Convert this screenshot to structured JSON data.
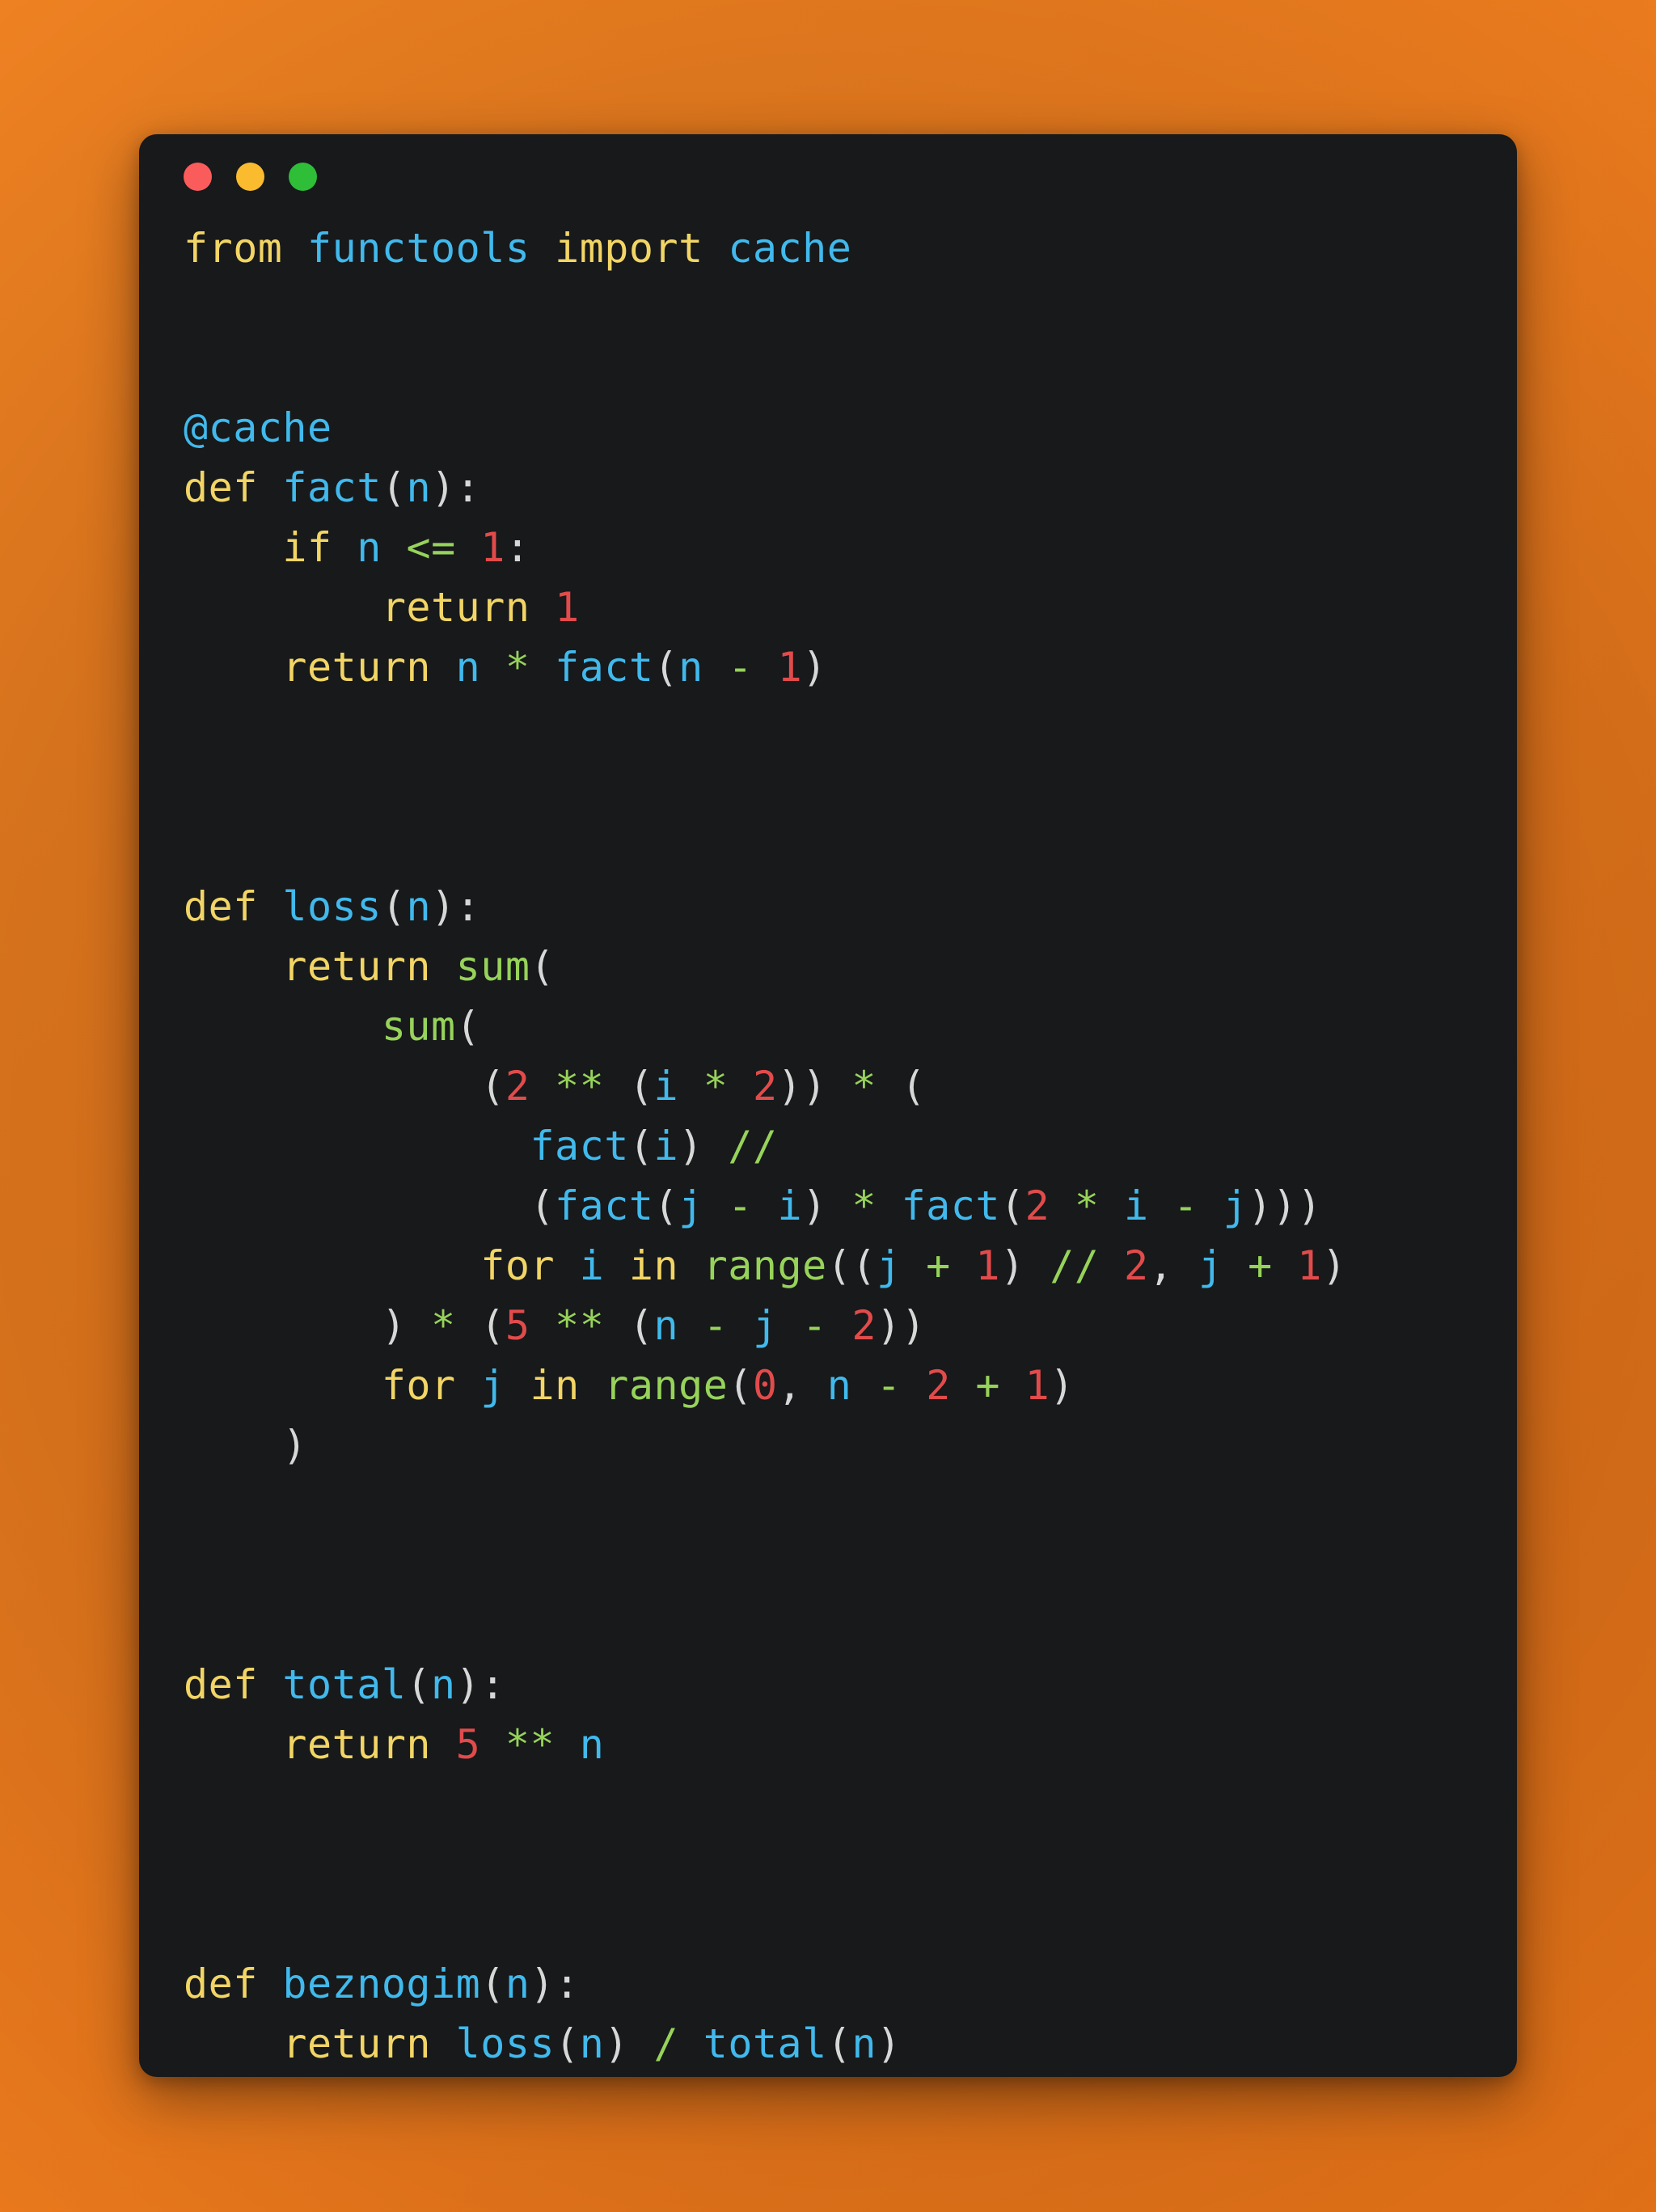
{
  "window": {
    "background_color": "#17191B",
    "page_background_color": "#EC7C1E",
    "traffic_lights": [
      {
        "name": "close",
        "color": "#FA5C5C"
      },
      {
        "name": "minimize",
        "color": "#FBBB2E"
      },
      {
        "name": "maximize",
        "color": "#2EBE37"
      }
    ]
  },
  "syntax_colors": {
    "keyword": "#F2D565",
    "identifier": "#41B9EC",
    "builtin": "#97D35A",
    "operator": "#97D35A",
    "number": "#E24B4B",
    "punctuation": "#D6D8D8"
  },
  "code": {
    "language": "python",
    "lines": [
      [
        {
          "t": "from",
          "c": "kw"
        },
        {
          "t": " ",
          "c": "pn"
        },
        {
          "t": "functools",
          "c": "id"
        },
        {
          "t": " ",
          "c": "pn"
        },
        {
          "t": "import",
          "c": "kw"
        },
        {
          "t": " ",
          "c": "pn"
        },
        {
          "t": "cache",
          "c": "id"
        }
      ],
      [],
      [],
      [
        {
          "t": "@cache",
          "c": "id"
        }
      ],
      [
        {
          "t": "def",
          "c": "kw"
        },
        {
          "t": " ",
          "c": "pn"
        },
        {
          "t": "fact",
          "c": "id"
        },
        {
          "t": "(",
          "c": "pn"
        },
        {
          "t": "n",
          "c": "id"
        },
        {
          "t": "):",
          "c": "pn"
        }
      ],
      [
        {
          "t": "    ",
          "c": "pn"
        },
        {
          "t": "if",
          "c": "kw"
        },
        {
          "t": " ",
          "c": "pn"
        },
        {
          "t": "n",
          "c": "id"
        },
        {
          "t": " ",
          "c": "pn"
        },
        {
          "t": "<=",
          "c": "op"
        },
        {
          "t": " ",
          "c": "pn"
        },
        {
          "t": "1",
          "c": "num"
        },
        {
          "t": ":",
          "c": "pn"
        }
      ],
      [
        {
          "t": "        ",
          "c": "pn"
        },
        {
          "t": "return",
          "c": "kw"
        },
        {
          "t": " ",
          "c": "pn"
        },
        {
          "t": "1",
          "c": "num"
        }
      ],
      [
        {
          "t": "    ",
          "c": "pn"
        },
        {
          "t": "return",
          "c": "kw"
        },
        {
          "t": " ",
          "c": "pn"
        },
        {
          "t": "n",
          "c": "id"
        },
        {
          "t": " ",
          "c": "pn"
        },
        {
          "t": "*",
          "c": "op"
        },
        {
          "t": " ",
          "c": "pn"
        },
        {
          "t": "fact",
          "c": "id"
        },
        {
          "t": "(",
          "c": "pn"
        },
        {
          "t": "n",
          "c": "id"
        },
        {
          "t": " ",
          "c": "pn"
        },
        {
          "t": "-",
          "c": "op"
        },
        {
          "t": " ",
          "c": "pn"
        },
        {
          "t": "1",
          "c": "num"
        },
        {
          "t": ")",
          "c": "pn"
        }
      ],
      [],
      [],
      [],
      [
        {
          "t": "def",
          "c": "kw"
        },
        {
          "t": " ",
          "c": "pn"
        },
        {
          "t": "loss",
          "c": "id"
        },
        {
          "t": "(",
          "c": "pn"
        },
        {
          "t": "n",
          "c": "id"
        },
        {
          "t": "):",
          "c": "pn"
        }
      ],
      [
        {
          "t": "    ",
          "c": "pn"
        },
        {
          "t": "return",
          "c": "kw"
        },
        {
          "t": " ",
          "c": "pn"
        },
        {
          "t": "sum",
          "c": "bi"
        },
        {
          "t": "(",
          "c": "pn"
        }
      ],
      [
        {
          "t": "        ",
          "c": "pn"
        },
        {
          "t": "sum",
          "c": "bi"
        },
        {
          "t": "(",
          "c": "pn"
        }
      ],
      [
        {
          "t": "            ",
          "c": "pn"
        },
        {
          "t": "(",
          "c": "pn"
        },
        {
          "t": "2",
          "c": "num"
        },
        {
          "t": " ",
          "c": "pn"
        },
        {
          "t": "**",
          "c": "op"
        },
        {
          "t": " ",
          "c": "pn"
        },
        {
          "t": "(",
          "c": "pn"
        },
        {
          "t": "i",
          "c": "id"
        },
        {
          "t": " ",
          "c": "pn"
        },
        {
          "t": "*",
          "c": "op"
        },
        {
          "t": " ",
          "c": "pn"
        },
        {
          "t": "2",
          "c": "num"
        },
        {
          "t": "))",
          "c": "pn"
        },
        {
          "t": " ",
          "c": "pn"
        },
        {
          "t": "*",
          "c": "op"
        },
        {
          "t": " ",
          "c": "pn"
        },
        {
          "t": "(",
          "c": "pn"
        }
      ],
      [
        {
          "t": "              ",
          "c": "pn"
        },
        {
          "t": "fact",
          "c": "id"
        },
        {
          "t": "(",
          "c": "pn"
        },
        {
          "t": "i",
          "c": "id"
        },
        {
          "t": ")",
          "c": "pn"
        },
        {
          "t": " ",
          "c": "pn"
        },
        {
          "t": "//",
          "c": "op"
        }
      ],
      [
        {
          "t": "              ",
          "c": "pn"
        },
        {
          "t": "(",
          "c": "pn"
        },
        {
          "t": "fact",
          "c": "id"
        },
        {
          "t": "(",
          "c": "pn"
        },
        {
          "t": "j",
          "c": "id"
        },
        {
          "t": " ",
          "c": "pn"
        },
        {
          "t": "-",
          "c": "op"
        },
        {
          "t": " ",
          "c": "pn"
        },
        {
          "t": "i",
          "c": "id"
        },
        {
          "t": ")",
          "c": "pn"
        },
        {
          "t": " ",
          "c": "pn"
        },
        {
          "t": "*",
          "c": "op"
        },
        {
          "t": " ",
          "c": "pn"
        },
        {
          "t": "fact",
          "c": "id"
        },
        {
          "t": "(",
          "c": "pn"
        },
        {
          "t": "2",
          "c": "num"
        },
        {
          "t": " ",
          "c": "pn"
        },
        {
          "t": "*",
          "c": "op"
        },
        {
          "t": " ",
          "c": "pn"
        },
        {
          "t": "i",
          "c": "id"
        },
        {
          "t": " ",
          "c": "pn"
        },
        {
          "t": "-",
          "c": "op"
        },
        {
          "t": " ",
          "c": "pn"
        },
        {
          "t": "j",
          "c": "id"
        },
        {
          "t": ")))",
          "c": "pn"
        }
      ],
      [
        {
          "t": "            ",
          "c": "pn"
        },
        {
          "t": "for",
          "c": "kw"
        },
        {
          "t": " ",
          "c": "pn"
        },
        {
          "t": "i",
          "c": "id"
        },
        {
          "t": " ",
          "c": "pn"
        },
        {
          "t": "in",
          "c": "kw"
        },
        {
          "t": " ",
          "c": "pn"
        },
        {
          "t": "range",
          "c": "bi"
        },
        {
          "t": "((",
          "c": "pn"
        },
        {
          "t": "j",
          "c": "id"
        },
        {
          "t": " ",
          "c": "pn"
        },
        {
          "t": "+",
          "c": "op"
        },
        {
          "t": " ",
          "c": "pn"
        },
        {
          "t": "1",
          "c": "num"
        },
        {
          "t": ")",
          "c": "pn"
        },
        {
          "t": " ",
          "c": "pn"
        },
        {
          "t": "//",
          "c": "op"
        },
        {
          "t": " ",
          "c": "pn"
        },
        {
          "t": "2",
          "c": "num"
        },
        {
          "t": ", ",
          "c": "pn"
        },
        {
          "t": "j",
          "c": "id"
        },
        {
          "t": " ",
          "c": "pn"
        },
        {
          "t": "+",
          "c": "op"
        },
        {
          "t": " ",
          "c": "pn"
        },
        {
          "t": "1",
          "c": "num"
        },
        {
          "t": ")",
          "c": "pn"
        }
      ],
      [
        {
          "t": "        ",
          "c": "pn"
        },
        {
          "t": ")",
          "c": "pn"
        },
        {
          "t": " ",
          "c": "pn"
        },
        {
          "t": "*",
          "c": "op"
        },
        {
          "t": " ",
          "c": "pn"
        },
        {
          "t": "(",
          "c": "pn"
        },
        {
          "t": "5",
          "c": "num"
        },
        {
          "t": " ",
          "c": "pn"
        },
        {
          "t": "**",
          "c": "op"
        },
        {
          "t": " ",
          "c": "pn"
        },
        {
          "t": "(",
          "c": "pn"
        },
        {
          "t": "n",
          "c": "id"
        },
        {
          "t": " ",
          "c": "pn"
        },
        {
          "t": "-",
          "c": "op"
        },
        {
          "t": " ",
          "c": "pn"
        },
        {
          "t": "j",
          "c": "id"
        },
        {
          "t": " ",
          "c": "pn"
        },
        {
          "t": "-",
          "c": "op"
        },
        {
          "t": " ",
          "c": "pn"
        },
        {
          "t": "2",
          "c": "num"
        },
        {
          "t": "))",
          "c": "pn"
        }
      ],
      [
        {
          "t": "        ",
          "c": "pn"
        },
        {
          "t": "for",
          "c": "kw"
        },
        {
          "t": " ",
          "c": "pn"
        },
        {
          "t": "j",
          "c": "id"
        },
        {
          "t": " ",
          "c": "pn"
        },
        {
          "t": "in",
          "c": "kw"
        },
        {
          "t": " ",
          "c": "pn"
        },
        {
          "t": "range",
          "c": "bi"
        },
        {
          "t": "(",
          "c": "pn"
        },
        {
          "t": "0",
          "c": "num"
        },
        {
          "t": ", ",
          "c": "pn"
        },
        {
          "t": "n",
          "c": "id"
        },
        {
          "t": " ",
          "c": "pn"
        },
        {
          "t": "-",
          "c": "op"
        },
        {
          "t": " ",
          "c": "pn"
        },
        {
          "t": "2",
          "c": "num"
        },
        {
          "t": " ",
          "c": "pn"
        },
        {
          "t": "+",
          "c": "op"
        },
        {
          "t": " ",
          "c": "pn"
        },
        {
          "t": "1",
          "c": "num"
        },
        {
          "t": ")",
          "c": "pn"
        }
      ],
      [
        {
          "t": "    ",
          "c": "pn"
        },
        {
          "t": ")",
          "c": "pn"
        }
      ],
      [],
      [],
      [],
      [
        {
          "t": "def",
          "c": "kw"
        },
        {
          "t": " ",
          "c": "pn"
        },
        {
          "t": "total",
          "c": "id"
        },
        {
          "t": "(",
          "c": "pn"
        },
        {
          "t": "n",
          "c": "id"
        },
        {
          "t": "):",
          "c": "pn"
        }
      ],
      [
        {
          "t": "    ",
          "c": "pn"
        },
        {
          "t": "return",
          "c": "kw"
        },
        {
          "t": " ",
          "c": "pn"
        },
        {
          "t": "5",
          "c": "num"
        },
        {
          "t": " ",
          "c": "pn"
        },
        {
          "t": "**",
          "c": "op"
        },
        {
          "t": " ",
          "c": "pn"
        },
        {
          "t": "n",
          "c": "id"
        }
      ],
      [],
      [],
      [],
      [
        {
          "t": "def",
          "c": "kw"
        },
        {
          "t": " ",
          "c": "pn"
        },
        {
          "t": "beznogim",
          "c": "id"
        },
        {
          "t": "(",
          "c": "pn"
        },
        {
          "t": "n",
          "c": "id"
        },
        {
          "t": "):",
          "c": "pn"
        }
      ],
      [
        {
          "t": "    ",
          "c": "pn"
        },
        {
          "t": "return",
          "c": "kw"
        },
        {
          "t": " ",
          "c": "pn"
        },
        {
          "t": "loss",
          "c": "id"
        },
        {
          "t": "(",
          "c": "pn"
        },
        {
          "t": "n",
          "c": "id"
        },
        {
          "t": ")",
          "c": "pn"
        },
        {
          "t": " ",
          "c": "pn"
        },
        {
          "t": "/",
          "c": "op"
        },
        {
          "t": " ",
          "c": "pn"
        },
        {
          "t": "total",
          "c": "id"
        },
        {
          "t": "(",
          "c": "pn"
        },
        {
          "t": "n",
          "c": "id"
        },
        {
          "t": ")",
          "c": "pn"
        }
      ]
    ]
  }
}
